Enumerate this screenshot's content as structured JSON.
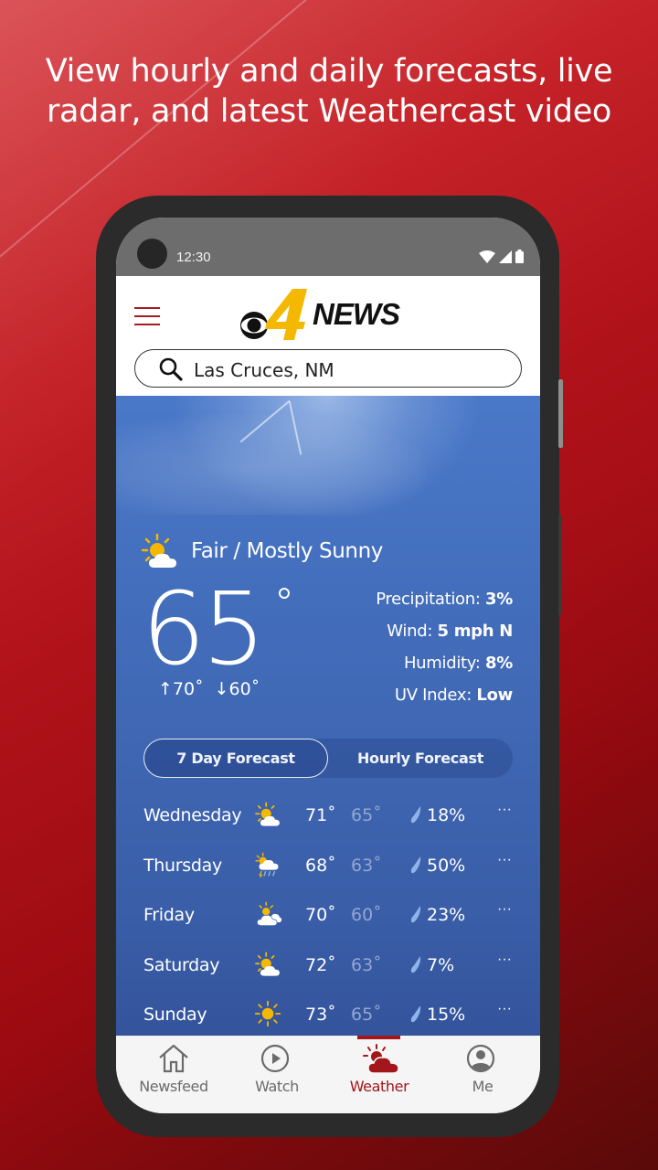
{
  "promo": {
    "headline_line1": "View hourly and daily forecasts, live",
    "headline_line2": "radar, and latest Weathercast video"
  },
  "status_bar": {
    "time": "12:30",
    "icons": [
      "wifi-icon",
      "signal-icon",
      "battery-icon"
    ]
  },
  "app_bar": {
    "menu_icon": "hamburger-menu-icon",
    "logo": {
      "network_mark": "cbs-eye-logo",
      "channel_number": "4",
      "word": "NEWS"
    },
    "search": {
      "icon": "search-icon",
      "value": "Las Cruces, NM"
    }
  },
  "current": {
    "condition_icon": "partly-sunny-icon",
    "condition": "Fair / Mostly Sunny",
    "temperature": "65",
    "high": "↑70˚",
    "low": "↓60˚",
    "details": [
      {
        "label": "Precipitation: ",
        "value": "3%"
      },
      {
        "label": "Wind: ",
        "value": "5 mph N"
      },
      {
        "label": "Humidity: ",
        "value": "8%"
      },
      {
        "label": "UV Index: ",
        "value": "Low"
      }
    ]
  },
  "forecast_tabs": {
    "active": "7 Day Forecast",
    "items": [
      "7 Day Forecast",
      "Hourly Forecast"
    ]
  },
  "daily": [
    {
      "day": "Wednesday",
      "icon": "partly-sunny-icon",
      "high": "71˚",
      "low": "65˚",
      "precip": "18%",
      "more": "···"
    },
    {
      "day": "Thursday",
      "icon": "sun-rain-icon",
      "high": "68˚",
      "low": "63˚",
      "precip": "50%",
      "more": "···"
    },
    {
      "day": "Friday",
      "icon": "mostly-cloudy-icon",
      "high": "70˚",
      "low": "60˚",
      "precip": "23%",
      "more": "···"
    },
    {
      "day": "Saturday",
      "icon": "partly-sunny-icon",
      "high": "72˚",
      "low": "63˚",
      "precip": "7%",
      "more": "···"
    },
    {
      "day": "Sunday",
      "icon": "sunny-icon",
      "high": "73˚",
      "low": "65˚",
      "precip": "15%",
      "more": "···"
    }
  ],
  "bottom_nav": {
    "active": "Weather",
    "items": [
      {
        "label": "Newsfeed",
        "icon": "home-icon"
      },
      {
        "label": "Watch",
        "icon": "play-circle-icon"
      },
      {
        "label": "Weather",
        "icon": "weather-icon"
      },
      {
        "label": "Me",
        "icon": "profile-icon"
      }
    ]
  },
  "colors": {
    "brand_red": "#a3161b",
    "logo_yellow": "#f5b800",
    "weather_blue": "#4470bf",
    "inactive_gray": "#6b6b6b"
  }
}
